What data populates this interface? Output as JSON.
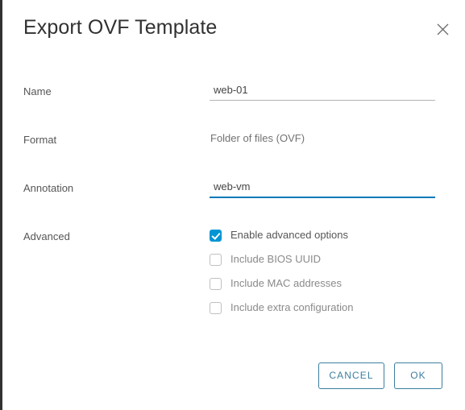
{
  "dialog": {
    "title": "Export OVF Template",
    "close_icon": "close-icon"
  },
  "fields": {
    "name": {
      "label": "Name",
      "value": "web-01",
      "placeholder": ""
    },
    "format": {
      "label": "Format",
      "value": "Folder of files (OVF)"
    },
    "annotation": {
      "label": "Annotation",
      "value": "web-vm",
      "placeholder": "",
      "focused": true
    },
    "advanced": {
      "label": "Advanced",
      "options": [
        {
          "label": "Enable advanced options",
          "checked": true
        },
        {
          "label": "Include BIOS UUID",
          "checked": false
        },
        {
          "label": "Include MAC addresses",
          "checked": false
        },
        {
          "label": "Include extra configuration",
          "checked": false
        }
      ]
    }
  },
  "footer": {
    "cancel_label": "Cancel",
    "ok_label": "OK"
  },
  "colors": {
    "accent": "#0079b8",
    "checkbox_checked": "#0095d3",
    "button_border": "#3c7ea0",
    "label_text": "#565656",
    "muted_text": "#8a8a8a"
  }
}
